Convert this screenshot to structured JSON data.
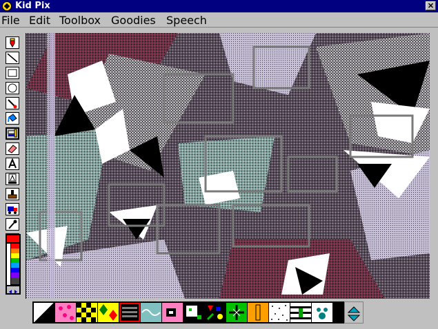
{
  "window": {
    "title": "Kid Pix",
    "close_glyph": "✕"
  },
  "menu": [
    {
      "label": "File"
    },
    {
      "label": "Edit"
    },
    {
      "label": "Toolbox"
    },
    {
      "label": "Goodies"
    },
    {
      "label": "Speech"
    }
  ],
  "tools": [
    {
      "name": "pencil-tool-icon"
    },
    {
      "name": "line-tool-icon"
    },
    {
      "name": "rectangle-tool-icon"
    },
    {
      "name": "oval-tool-icon"
    },
    {
      "name": "wacky-brush-tool-icon"
    },
    {
      "name": "paint-can-tool-icon"
    },
    {
      "name": "eraser-mix-tool-icon"
    },
    {
      "name": "eraser-tool-icon"
    },
    {
      "name": "text-tool-icon"
    },
    {
      "name": "alphabet-stamp-tool-icon"
    },
    {
      "name": "rubber-stamp-tool-icon"
    },
    {
      "name": "truck-tool-icon"
    },
    {
      "name": "eyedropper-tool-icon"
    },
    {
      "name": "face-undo-tool-icon"
    }
  ],
  "active_tool": "eraser-mix-tool-icon",
  "palette_colors": [
    "#ff0000",
    "#ff8000",
    "#ffff00",
    "#00c000",
    "#00a0ff",
    "#0000ff",
    "#8000ff",
    "#000000"
  ],
  "tile_options": [
    {
      "name": "diagonal-split-pattern-icon"
    },
    {
      "name": "pink-dots-pattern-icon"
    },
    {
      "name": "yellow-checker-pattern-icon"
    },
    {
      "name": "yellow-diamond-pattern-icon"
    },
    {
      "name": "black-stripes-pattern-icon"
    },
    {
      "name": "wave-pattern-icon"
    },
    {
      "name": "pink-block-pattern-icon"
    },
    {
      "name": "pixel-face-pattern-icon"
    },
    {
      "name": "confetti-shapes-pattern-icon"
    },
    {
      "name": "green-cross-pattern-icon"
    },
    {
      "name": "orange-bar-pattern-icon"
    },
    {
      "name": "speckle-pattern-icon"
    },
    {
      "name": "cactus-stripe-pattern-icon"
    },
    {
      "name": "paw-print-pattern-icon"
    }
  ],
  "selected_tile": "black-stripes-pattern-icon",
  "colors": {
    "title_bar": "#000080",
    "chrome": "#c0c0c0",
    "selection_highlight": "#ff0000"
  }
}
